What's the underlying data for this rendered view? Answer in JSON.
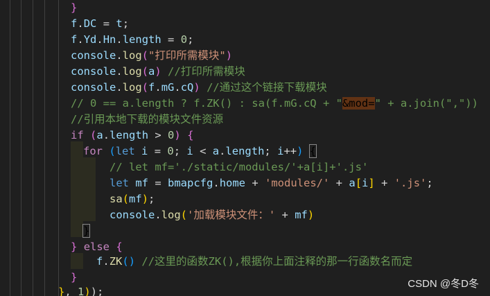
{
  "editor": {
    "lines": [
      [
        [
          "b2",
          "}"
        ]
      ],
      [
        [
          "v",
          "f"
        ],
        [
          "p",
          "."
        ],
        [
          "v",
          "DC"
        ],
        [
          "p",
          " = "
        ],
        [
          "v",
          "t"
        ],
        [
          "p",
          ";"
        ]
      ],
      [
        [
          "v",
          "f"
        ],
        [
          "p",
          "."
        ],
        [
          "v",
          "Yd"
        ],
        [
          "p",
          "."
        ],
        [
          "v",
          "Hn"
        ],
        [
          "p",
          "."
        ],
        [
          "v",
          "length"
        ],
        [
          "p",
          " = "
        ],
        [
          "n",
          "0"
        ],
        [
          "p",
          ";"
        ]
      ],
      [
        [
          "v",
          "console"
        ],
        [
          "p",
          "."
        ],
        [
          "f",
          "log"
        ],
        [
          "b2",
          "("
        ],
        [
          "s",
          "\"打印所需模块\""
        ],
        [
          "b2",
          ")"
        ]
      ],
      [
        [
          "v",
          "console"
        ],
        [
          "p",
          "."
        ],
        [
          "f",
          "log"
        ],
        [
          "b2",
          "("
        ],
        [
          "v",
          "a"
        ],
        [
          "b2",
          ")"
        ],
        [
          "c",
          " //打印所需模块"
        ]
      ],
      [
        [
          "v",
          "console"
        ],
        [
          "p",
          "."
        ],
        [
          "f",
          "log"
        ],
        [
          "b2",
          "("
        ],
        [
          "v",
          "f"
        ],
        [
          "p",
          "."
        ],
        [
          "v",
          "mG"
        ],
        [
          "p",
          "."
        ],
        [
          "v",
          "cQ"
        ],
        [
          "b2",
          ")"
        ],
        [
          "c",
          " //通过这个链接下载模块"
        ]
      ],
      [
        [
          "c",
          "// 0 == a.length ? f.ZK() : sa(f.mG.cQ + \""
        ],
        [
          "hl",
          "&mod="
        ],
        [
          "c",
          "\" + a.join(\",\"))"
        ]
      ],
      [
        [
          "c",
          "//引用本地下载的模块文件资源"
        ]
      ],
      [
        [
          "kc",
          "if"
        ],
        [
          "p",
          " "
        ],
        [
          "b2",
          "("
        ],
        [
          "v",
          "a"
        ],
        [
          "p",
          "."
        ],
        [
          "v",
          "length"
        ],
        [
          "p",
          " > "
        ],
        [
          "n",
          "0"
        ],
        [
          "b2",
          ")"
        ],
        [
          "p",
          " "
        ],
        [
          "b2",
          "{"
        ]
      ],
      [
        [
          "kc",
          "for"
        ],
        [
          "p",
          " "
        ],
        [
          "b3",
          "("
        ],
        [
          "k",
          "let"
        ],
        [
          "p",
          " "
        ],
        [
          "v",
          "i"
        ],
        [
          "p",
          " = "
        ],
        [
          "n",
          "0"
        ],
        [
          "p",
          "; "
        ],
        [
          "v",
          "i"
        ],
        [
          "p",
          " < "
        ],
        [
          "v",
          "a"
        ],
        [
          "p",
          "."
        ],
        [
          "v",
          "length"
        ],
        [
          "p",
          "; "
        ],
        [
          "v",
          "i"
        ],
        [
          "p",
          "++"
        ],
        [
          "b3",
          ")"
        ],
        [
          "p",
          " "
        ],
        [
          "bm",
          "{"
        ]
      ],
      [
        [
          "c",
          "// let mf='./static/modules/'+a[i]+'.js'"
        ]
      ],
      [
        [
          "k",
          "let"
        ],
        [
          "p",
          " "
        ],
        [
          "v",
          "mf"
        ],
        [
          "p",
          " = "
        ],
        [
          "v",
          "bmapcfg"
        ],
        [
          "p",
          "."
        ],
        [
          "v",
          "home"
        ],
        [
          "p",
          " + "
        ],
        [
          "s",
          "'modules/'"
        ],
        [
          "p",
          " + "
        ],
        [
          "v",
          "a"
        ],
        [
          "b1",
          "["
        ],
        [
          "v",
          "i"
        ],
        [
          "b1",
          "]"
        ],
        [
          "p",
          " + "
        ],
        [
          "s",
          "'.js'"
        ],
        [
          "p",
          ";"
        ]
      ],
      [
        [
          "f",
          "sa"
        ],
        [
          "b1",
          "("
        ],
        [
          "v",
          "mf"
        ],
        [
          "b1",
          ")"
        ],
        [
          "p",
          ";"
        ]
      ],
      [
        [
          "v",
          "console"
        ],
        [
          "p",
          "."
        ],
        [
          "f",
          "log"
        ],
        [
          "b1",
          "("
        ],
        [
          "s",
          "'加载模块文件：'"
        ],
        [
          "p",
          " + "
        ],
        [
          "v",
          "mf"
        ],
        [
          "b1",
          ")"
        ]
      ],
      [
        [
          "bm",
          "}"
        ]
      ],
      [
        [
          "b2",
          "}"
        ],
        [
          "p",
          " "
        ],
        [
          "kc",
          "else"
        ],
        [
          "p",
          " "
        ],
        [
          "b2",
          "{"
        ]
      ],
      [
        [
          "v",
          "f"
        ],
        [
          "p",
          "."
        ],
        [
          "f",
          "ZK"
        ],
        [
          "b3",
          "()"
        ],
        [
          "c",
          " //这里的函数ZK(),根据你上面注释的那一行函数名而定"
        ]
      ],
      [
        [
          "b2",
          "}"
        ]
      ],
      [
        [
          "b1",
          "}"
        ],
        [
          "p",
          ", "
        ],
        [
          "n",
          "1"
        ],
        [
          "b1",
          ")"
        ],
        [
          "p",
          ");"
        ]
      ]
    ]
  },
  "watermark": "CSDN @冬D冬"
}
